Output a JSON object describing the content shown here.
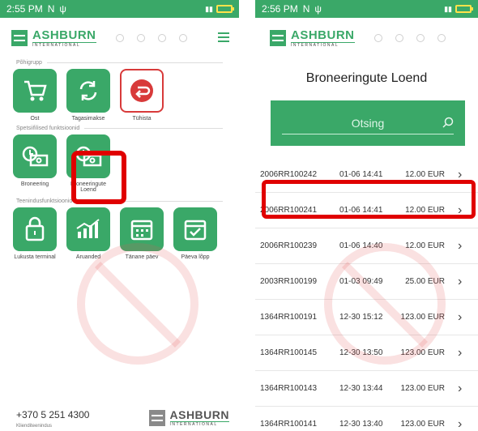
{
  "left": {
    "status": {
      "time": "2:55 PM"
    },
    "logo": {
      "name": "ASHBURN",
      "tagline": "INTERNATIONAL"
    },
    "sections": [
      {
        "title": "Põhigrupp",
        "items": [
          {
            "label": "Ost",
            "icon": "cart-icon"
          },
          {
            "label": "Tagasimakse",
            "icon": "refresh-icon"
          },
          {
            "label": "Tühista",
            "icon": "undo-icon"
          }
        ]
      },
      {
        "title": "Spetsiifilised funktsioonid",
        "items": [
          {
            "label": "Broneering",
            "icon": "clock-money-icon"
          },
          {
            "label": "Broneeringute Loend",
            "icon": "clock-money-icon"
          }
        ]
      },
      {
        "title": "Teenindusfunktsioonid",
        "items": [
          {
            "label": "Lukusta terminal",
            "icon": "lock-icon"
          },
          {
            "label": "Aruanded",
            "icon": "chart-icon"
          },
          {
            "label": "Tänane päev",
            "icon": "calendar-icon"
          },
          {
            "label": "Päeva lõpp",
            "icon": "calendar-check-icon"
          }
        ]
      }
    ],
    "footer": {
      "phone": "+370 5 251 4300",
      "label": "Klienditeenindus"
    }
  },
  "right": {
    "status": {
      "time": "2:56 PM"
    },
    "logo": {
      "name": "ASHBURN",
      "tagline": "INTERNATIONAL"
    },
    "title": "Broneeringute Loend",
    "search": {
      "placeholder": "Otsing"
    },
    "rows": [
      {
        "id": "2006RR100242",
        "date": "01-06 14:41",
        "amount": "12.00 EUR"
      },
      {
        "id": "2006RR100241",
        "date": "01-06 14:41",
        "amount": "12.00 EUR"
      },
      {
        "id": "2006RR100239",
        "date": "01-06 14:40",
        "amount": "12.00 EUR"
      },
      {
        "id": "2003RR100199",
        "date": "01-03 09:49",
        "amount": "25.00 EUR"
      },
      {
        "id": "1364RR100191",
        "date": "12-30 15:12",
        "amount": "123.00 EUR"
      },
      {
        "id": "1364RR100145",
        "date": "12-30 13:50",
        "amount": "123.00 EUR"
      },
      {
        "id": "1364RR100143",
        "date": "12-30 13:44",
        "amount": "123.00 EUR"
      },
      {
        "id": "1364RR100141",
        "date": "12-30 13:40",
        "amount": "123.00 EUR"
      }
    ]
  },
  "colors": {
    "brand": "#3aa868",
    "highlight": "#e00000",
    "cancel": "#d83a3a"
  }
}
